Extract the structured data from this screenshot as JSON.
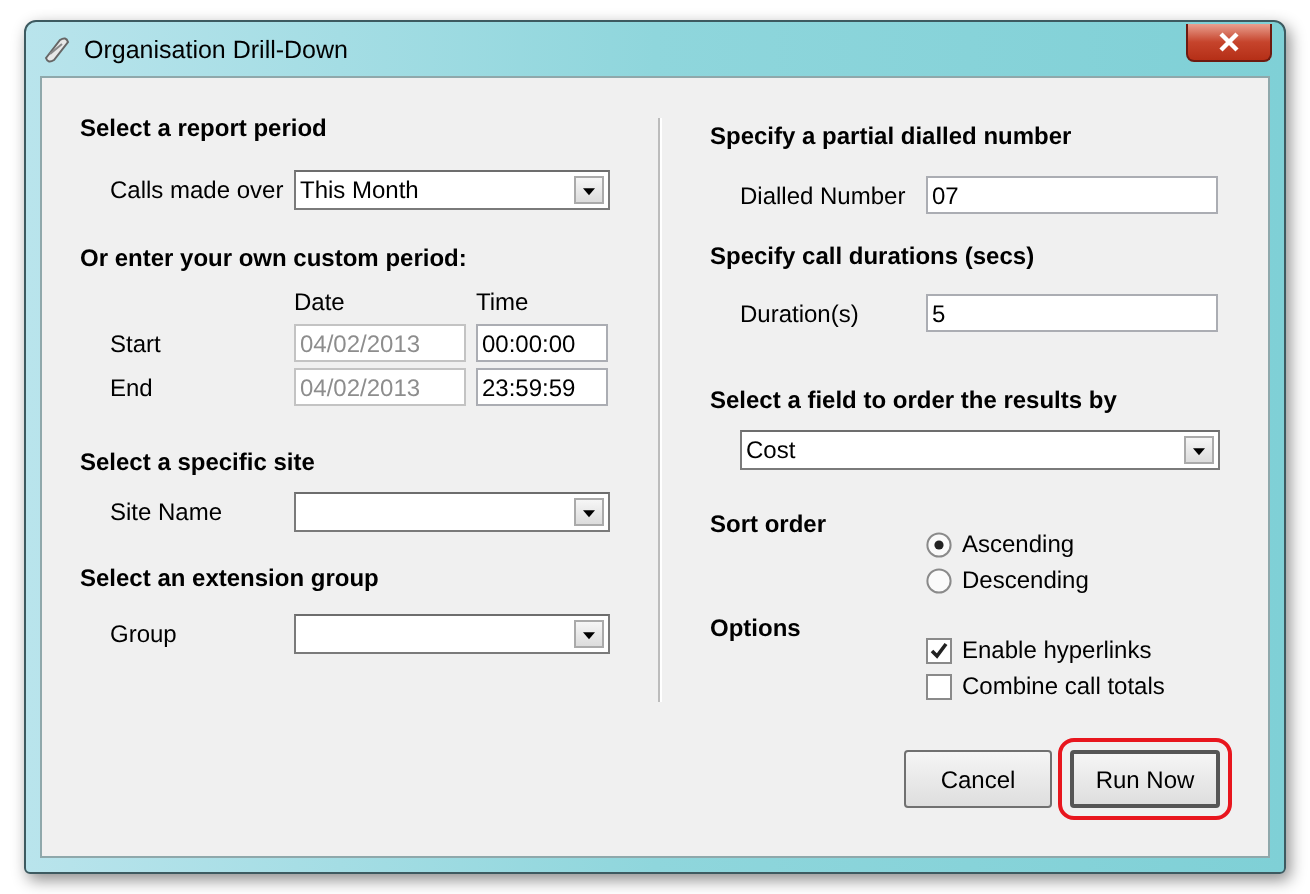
{
  "window": {
    "title": "Organisation Drill-Down"
  },
  "report_period": {
    "heading": "Select a report period",
    "label": "Calls made over",
    "value": "This Month"
  },
  "custom_period": {
    "heading": "Or enter your own custom period:",
    "column_labels": [
      "Date",
      "Time"
    ],
    "rows": [
      {
        "label": "Start",
        "date": {
          "value": "04/02/2013",
          "disabled": true
        },
        "time": {
          "value": "00:00:00",
          "disabled": false
        }
      },
      {
        "label": "End",
        "date": {
          "value": "04/02/2013",
          "disabled": true
        },
        "time": {
          "value": "23:59:59",
          "disabled": false
        }
      }
    ]
  },
  "site": {
    "heading": "Select a specific site",
    "label": "Site Name"
  },
  "group": {
    "heading": "Select an extension group",
    "label": "Group"
  },
  "dialled": {
    "heading": "Specify a partial dialled number",
    "label": "Dialled Number",
    "value": "07"
  },
  "duration": {
    "heading": "Specify call durations (secs)",
    "label": "Duration(s)",
    "value": "5"
  },
  "order": {
    "heading": "Select a field to order the results by",
    "value": "Cost"
  },
  "sort": {
    "heading": "Sort order",
    "options": [
      {
        "label": "Ascending",
        "selected": true
      },
      {
        "label": "Descending",
        "selected": false
      }
    ]
  },
  "options": {
    "heading": "Options",
    "items": [
      {
        "label": "Enable hyperlinks",
        "checked": true
      },
      {
        "label": "Combine call totals",
        "checked": false
      }
    ]
  },
  "buttons": [
    {
      "label": "Cancel",
      "highlighted": false
    },
    {
      "label": "Run Now",
      "highlighted": true
    }
  ]
}
